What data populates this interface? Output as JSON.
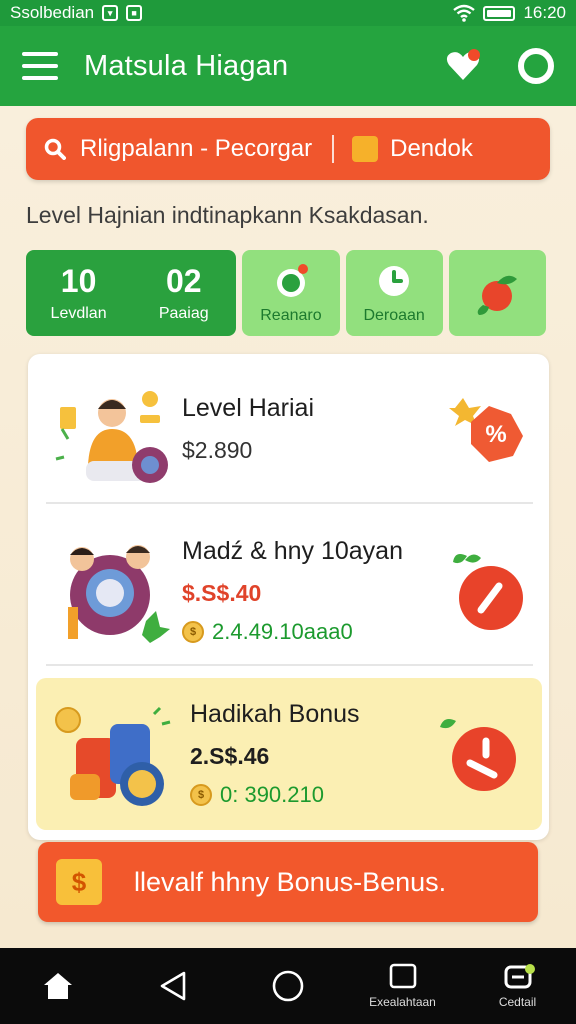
{
  "status_bar": {
    "carrier": "Ssolbedian",
    "time": "16:20"
  },
  "app_bar": {
    "title": "Matsula Hiagan",
    "icons": [
      "menu-icon",
      "heart-icon",
      "refresh-icon"
    ]
  },
  "search": {
    "text": "Rligpalann - Pecorgar",
    "filter_label": "Dendok",
    "icons": [
      "search-icon",
      "gift-icon"
    ]
  },
  "subtitle": "Level Hajnian indtinapkann Ksakdasan.",
  "tiles": [
    {
      "value": "10",
      "label": "Levdlan"
    },
    {
      "value": "02",
      "label": "Paaiag"
    },
    {
      "value": "",
      "label": "Reanaro"
    },
    {
      "value": "",
      "label": "Deroaan"
    },
    {
      "value": "",
      "label": ""
    }
  ],
  "rewards": [
    {
      "title": "Level Hariai",
      "price": "$2.890",
      "coins": ""
    },
    {
      "title": "Madź & hny 10ayan",
      "price": "$.S$.40",
      "coins": "2.4.49.10aaa0"
    },
    {
      "title": "Hadikah Bonus",
      "price": "2.S$.46",
      "coins": "0: 390.210"
    }
  ],
  "bonus_button": {
    "icon_text": "$",
    "label": "llevalf hhny Bonus-Benus."
  },
  "nav": [
    {
      "label": "",
      "icon": "home-icon"
    },
    {
      "label": "",
      "icon": "back-icon"
    },
    {
      "label": "",
      "icon": "circle-home-icon"
    },
    {
      "label": "Exealahtaan",
      "icon": "square-icon"
    },
    {
      "label": "Cedtail",
      "icon": "profile-icon"
    }
  ],
  "colors": {
    "primary_green": "#25a43f",
    "accent_orange": "#f0562d",
    "light_green": "#92e07e",
    "background": "#f7ecd6",
    "highlight_yellow": "#fbefb3"
  }
}
